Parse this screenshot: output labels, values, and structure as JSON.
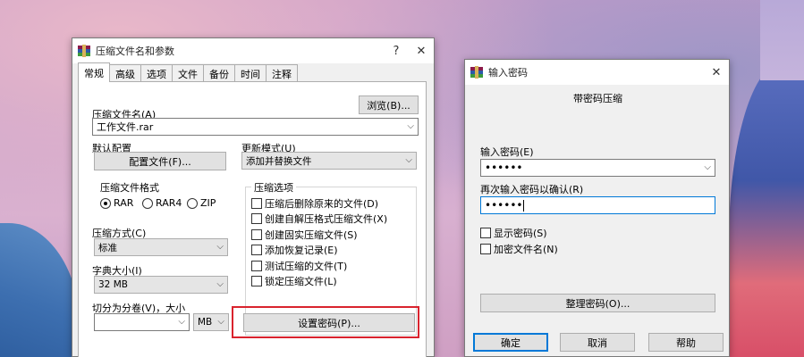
{
  "archive_dialog": {
    "title": "压缩文件名和参数",
    "help": "?",
    "close": "✕",
    "tabs": [
      "常规",
      "高级",
      "选项",
      "文件",
      "备份",
      "时间",
      "注释"
    ],
    "archive_name_label": "压缩文件名(A)",
    "browse_button": "浏览(B)...",
    "archive_name_value": "工作文件.rar",
    "default_profile_label": "默认配置",
    "profiles_button": "配置文件(F)...",
    "update_mode_label": "更新模式(U)",
    "update_mode_value": "添加并替换文件",
    "format_group_title": "压缩文件格式",
    "formats": [
      "RAR",
      "RAR4",
      "ZIP"
    ],
    "format_selected": "RAR",
    "options_group_title": "压缩选项",
    "options": [
      "压缩后删除原来的文件(D)",
      "创建自解压格式压缩文件(X)",
      "创建固实压缩文件(S)",
      "添加恢复记录(E)",
      "测试压缩的文件(T)",
      "锁定压缩文件(L)"
    ],
    "method_label": "压缩方式(C)",
    "method_value": "标准",
    "dict_label": "字典大小(I)",
    "dict_value": "32 MB",
    "split_label": "切分为分卷(V)，大小",
    "split_value": "",
    "split_unit": "MB",
    "set_password_button": "设置密码(P)..."
  },
  "password_dialog": {
    "title": "输入密码",
    "close": "✕",
    "header": "带密码压缩",
    "enter_label": "输入密码(E)",
    "enter_value": "••••••",
    "reenter_label": "再次输入密码以确认(R)",
    "reenter_value": "••••••",
    "show_password": "显示密码(S)",
    "encrypt_names": "加密文件名(N)",
    "organize_button": "整理密码(O)...",
    "ok_button": "确定",
    "cancel_button": "取消",
    "help_button": "帮助"
  },
  "colors": {
    "highlight": "#d9232e",
    "focus": "#0078d7"
  }
}
